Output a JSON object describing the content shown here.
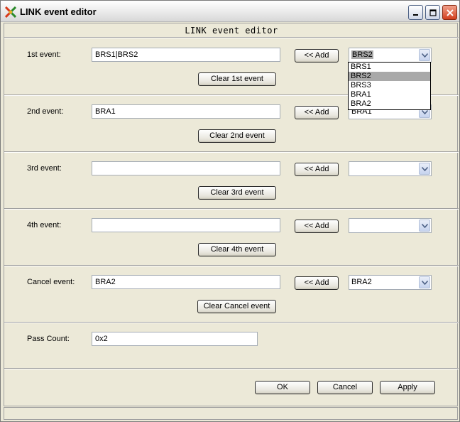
{
  "window": {
    "title": "LINK event editor",
    "minimize_icon": "minimize-icon",
    "maximize_icon": "maximize-icon",
    "close_icon": "close-icon"
  },
  "header": {
    "label": "LINK event editor"
  },
  "add_label": "<< Add",
  "rows": [
    {
      "label": "1st event:",
      "value": "BRS1|BRS2",
      "combo_value": "BRS2",
      "clear_label": "Clear 1st event"
    },
    {
      "label": "2nd event:",
      "value": "BRA1",
      "combo_value": "BRA1",
      "clear_label": "Clear 2nd event"
    },
    {
      "label": "3rd event:",
      "value": "",
      "combo_value": "",
      "clear_label": "Clear 3rd event"
    },
    {
      "label": "4th event:",
      "value": "",
      "combo_value": "",
      "clear_label": "Clear 4th event"
    },
    {
      "label": "Cancel event:",
      "value": "BRA2",
      "combo_value": "BRA2",
      "clear_label": "Clear Cancel event"
    }
  ],
  "dropdown": {
    "options": [
      "BRS1",
      "BRS2",
      "BRS3",
      "BRA1",
      "BRA2"
    ],
    "highlighted": "BRS2"
  },
  "pass_count": {
    "label": "Pass Count:",
    "value": "0x2"
  },
  "footer": {
    "ok_label": "OK",
    "cancel_label": "Cancel",
    "apply_label": "Apply"
  },
  "colors": {
    "window_bg": "#ece9d8",
    "close_button": "#d2401e",
    "highlight": "#a9a9a9"
  }
}
